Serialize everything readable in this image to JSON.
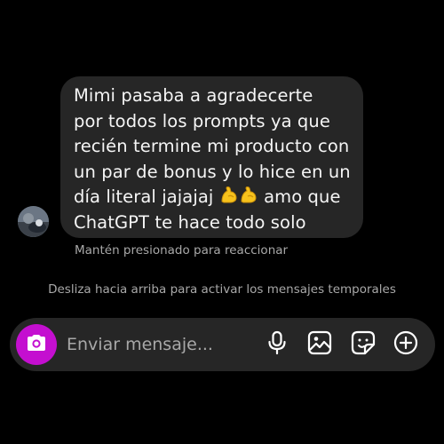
{
  "message": {
    "lines": [
      "Mimi pasaba a agradecerte",
      "por todos los prompts ya que",
      "recién termine mi producto con",
      "un par de bonus y lo hice en un",
      "día literal jajajaj",
      "ChatGPT te hace todo solo"
    ],
    "line5_after_emoji": "amo que",
    "emojis": [
      "flexed-biceps-icon",
      "flexed-biceps-icon"
    ]
  },
  "reaction_hint": "Mantén presionado para reaccionar",
  "temporary_messages_hint": "Desliza hacia arriba para activar los mensajes temporales",
  "composer": {
    "placeholder": "Enviar mensaje...",
    "icons": [
      "camera-icon",
      "microphone-icon",
      "gallery-icon",
      "sticker-icon",
      "add-icon"
    ]
  },
  "colors": {
    "background": "#000000",
    "bubble": "#262626",
    "camera_button": "#c40fd0",
    "secondary_text": "#a8a8a8"
  }
}
